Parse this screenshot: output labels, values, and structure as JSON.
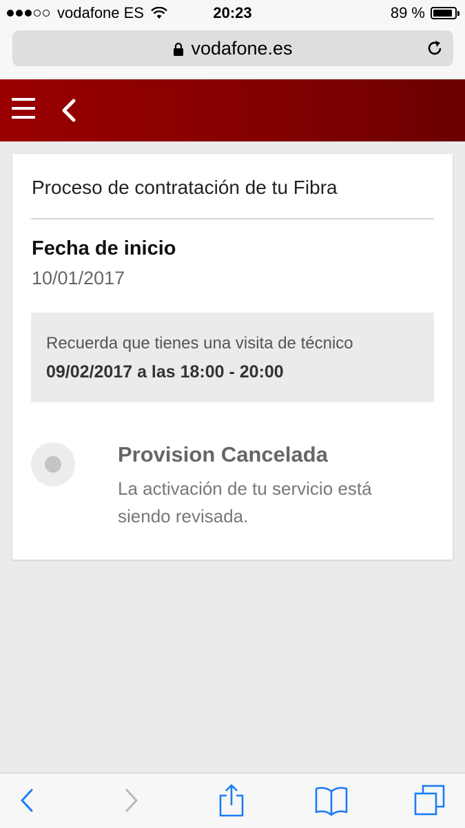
{
  "status_bar": {
    "carrier": "vodafone ES",
    "time": "20:23",
    "battery_text": "89 %",
    "battery_level": 0.89
  },
  "browser": {
    "url": "vodafone.es"
  },
  "colors": {
    "header_red": "#820000",
    "ios_blue": "#1a7cf5"
  },
  "card": {
    "title": "Proceso de contratación de tu Fibra",
    "start_label": "Fecha de inicio",
    "start_date": "10/01/2017",
    "visit": {
      "text": "Recuerda que tienes una visita de técnico",
      "datetime": "09/02/2017 a las 18:00 - 20:00"
    },
    "status": {
      "title": "Provision Cancelada",
      "description": "La activación de tu servicio está siendo revisada."
    }
  },
  "icons": {
    "header": [
      "menu-icon",
      "back-arrow-icon"
    ],
    "toolbar": [
      "back-icon",
      "forward-icon",
      "share-icon",
      "bookmarks-icon",
      "tabs-icon"
    ]
  }
}
